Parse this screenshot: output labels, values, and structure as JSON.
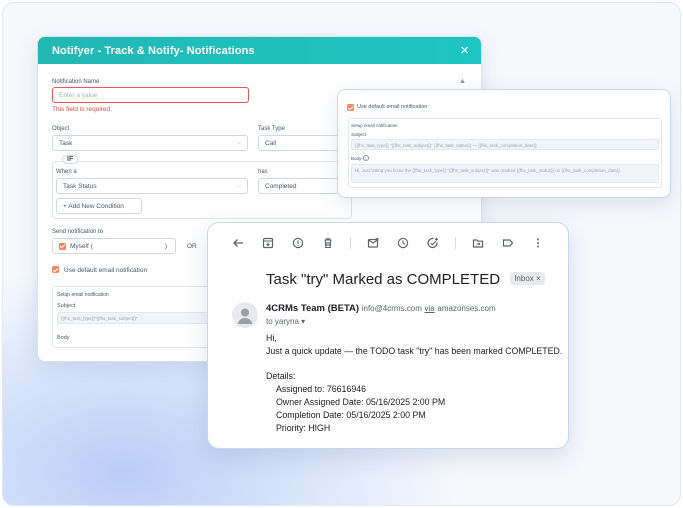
{
  "modal": {
    "title": "Notifyer - Track & Notify- Notifications",
    "close_icon": "×",
    "notification_name_label": "Notification Name",
    "notification_name_placeholder": "Enter a value",
    "required_error": "This field is required.",
    "object_label": "Object",
    "object_value": "Task",
    "task_type_label": "Task Type",
    "task_type_value": "Call",
    "if_label": "IF",
    "when_label": "When a",
    "when_value": "Task Status",
    "has_label": "has",
    "has_value": "Completed",
    "add_condition": "+ Add New Condition",
    "send_to_label": "Send notification to",
    "send_to_value": "Myself (",
    "send_to_close": ")",
    "or_label": "OR",
    "use_default_email": "Use default email notification",
    "setup_label": "Setup email notification",
    "subject_label": "Subject",
    "subject_value": "{{fhs_task_type}}\"{{fhs_task_subject}}\"",
    "body_label": "Body"
  },
  "email_panel": {
    "use_default_email": "Use default email notification",
    "setup_label": "Setup email notification",
    "subject_label": "Subject",
    "subject_value": "{{fhs_task_type}} \"{{fhs_task_subject}}\" {{fhs_task_status}} — {{fhs_task_completion_date}}",
    "body_label": "Body",
    "body_value": "Hi, Just letting you know the {{fhs_task_type}} \"{{fhs_task_subject}}\" was marked {{fhs_task_status}} on {{fhs_task_completion_date}}."
  },
  "mail": {
    "subject": "Task \"try\" Marked as COMPLETED",
    "badge": "Inbox",
    "badge_close": "×",
    "sender_name": "4CRMs Team (BETA)",
    "sender_email": "info@4crms.com",
    "via": "via",
    "via_domain": "amazonses.com",
    "to_line": "to yaryna ▾",
    "greeting": "Hi,",
    "line1": "Just a quick update — the TODO task \"try\" has been marked COMPLETED.",
    "details_label": "Details:",
    "assigned_to": "Assigned to: 76616946",
    "owner_date": "Owner Assigned Date: 05/16/2025 2:00 PM",
    "completion_date": "Completion Date: 05/16/2025 2:00 PM",
    "priority": "Priority: HIGH"
  },
  "colors": {
    "header_teal": "#1dbfbb",
    "checkbox_orange": "#f08a5d",
    "error_red": "#e14b4b"
  },
  "icons": [
    "back-arrow-icon",
    "archive-icon",
    "report-spam-icon",
    "delete-icon",
    "mark-unread-icon",
    "snooze-icon",
    "add-task-icon",
    "move-to-icon",
    "label-icon",
    "more-options-icon",
    "collapse-icon",
    "info-icon"
  ]
}
